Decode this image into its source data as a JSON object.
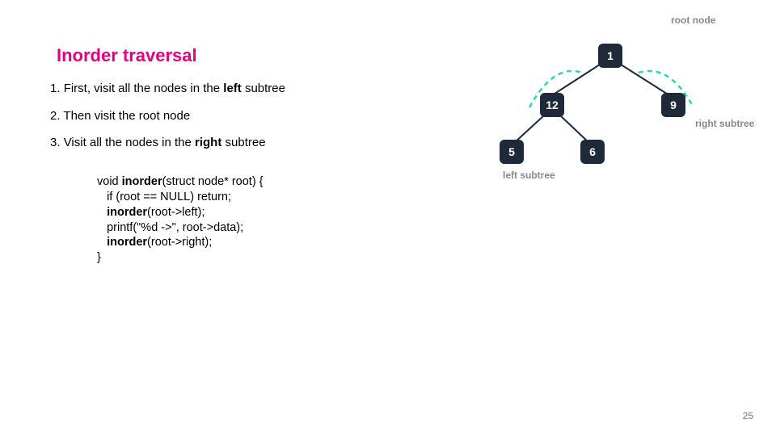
{
  "title": "Inorder traversal",
  "steps": [
    {
      "num": "1.",
      "pre": "First, visit all the nodes in the ",
      "bold": "left",
      "post": " subtree"
    },
    {
      "num": "2.",
      "pre": "Then visit the root node",
      "bold": "",
      "post": ""
    },
    {
      "num": "3.",
      "pre": "Visit all the nodes in the ",
      "bold": "right",
      "post": " subtree"
    }
  ],
  "code": {
    "l1a": "void ",
    "l1b": "inorder",
    "l1c": "(struct node* root) {",
    "l2": "   if (root == NULL) return;",
    "l3a": "   ",
    "l3b": "inorder",
    "l3c": "(root->left);",
    "l4": "   printf(\"%d ->\", root->data);",
    "l5a": "   ",
    "l5b": "inorder",
    "l5c": "(root->right);",
    "l6": "}"
  },
  "tree": {
    "root": "1",
    "left": "12",
    "right": "9",
    "leftleft": "5",
    "leftright": "6",
    "label_root": "root node",
    "label_left": "left subtree",
    "label_right": "right subtree"
  },
  "page": "25",
  "colors": {
    "teal": "#2dd4bf",
    "navy": "#1e2a3a",
    "grey": "#888"
  }
}
